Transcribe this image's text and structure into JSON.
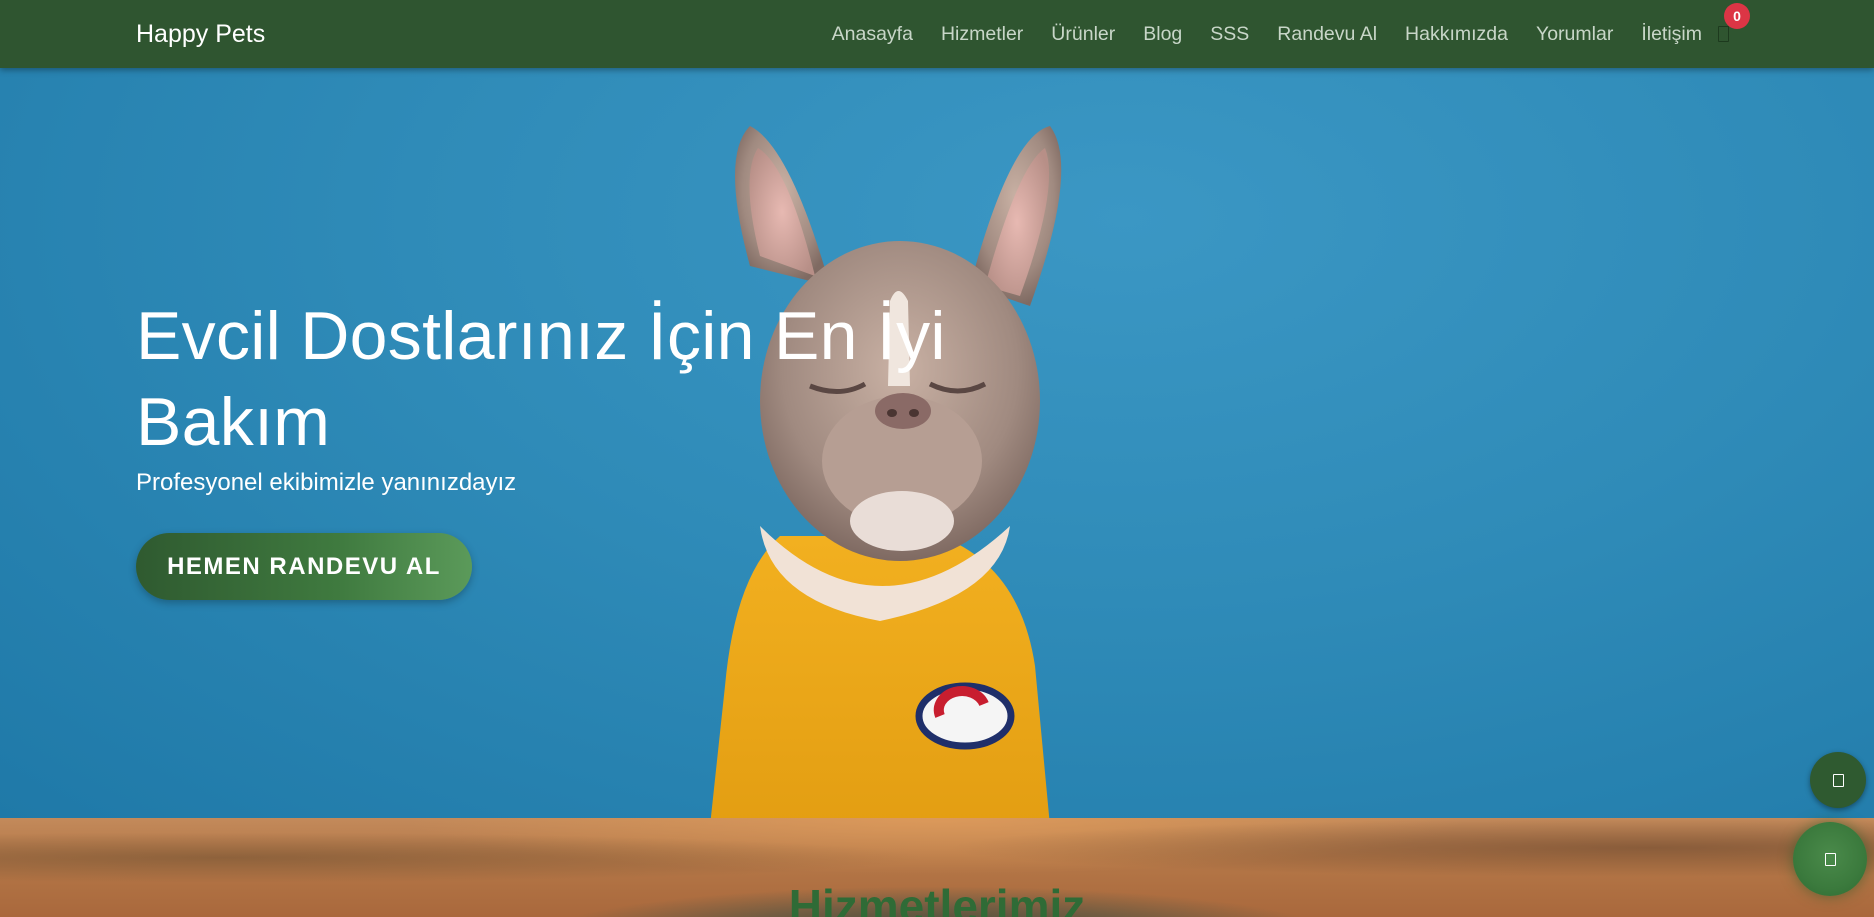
{
  "navbar": {
    "brand": "Happy Pets",
    "links": [
      "Anasayfa",
      "Hizmetler",
      "Ürünler",
      "Blog",
      "SSS",
      "Randevu Al",
      "Hakkımızda",
      "Yorumlar",
      "İletişim"
    ],
    "cart_icon": "cart-icon",
    "cart_count": "0"
  },
  "hero": {
    "title": "Evcil Dostlarınız İçin En İyi Bakım",
    "subtitle": "Profesyonel ekibimizle yanınızdayız",
    "cta_label": "HEMEN RANDEVU AL"
  },
  "services": {
    "title": "Hizmetlerimiz"
  },
  "floating": {
    "top_button_icon": "arrow-up-icon",
    "chat_button_icon": "chat-icon"
  },
  "colors": {
    "navbar_bg": "#2f5530",
    "hero_bg": "#2f8bb8",
    "accent_green": "#3f7a3f",
    "badge_red": "#dc3545"
  }
}
